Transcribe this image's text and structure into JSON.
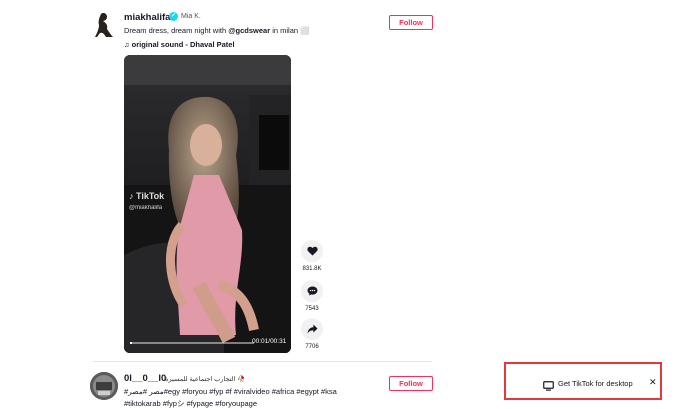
{
  "post1": {
    "username": "miakhalifa",
    "nickname": "Mia K.",
    "caption_text": "Dream dress, dream night with ",
    "caption_tag": "@gcdswear",
    "caption_end": " in milan ⬜",
    "sound": "original sound - Dhaval Patel",
    "follow_label": "Follow",
    "watermark": "TikTok",
    "watermark_user": "@miakhalifa",
    "video_time": "00:01/00:31",
    "video_progress_percent": 2,
    "likes": "831.8K",
    "comments": "7543",
    "shares": "7706"
  },
  "post2": {
    "username": "0l__0__l0",
    "nickname": "التجارب اجتماعية للمسيرة 🥀",
    "tags_line1": "#مصر #مصر#egy #foryou #fyp #f #viralvideo #africa #egypt #ksa",
    "tags_line2": "#tiktokarab #fypシ #fypage #foryoupage",
    "follow_label": "Follow"
  },
  "desktop_prompt": {
    "label": "Get TikTok for desktop",
    "close_label": "✕"
  },
  "colors": {
    "accent": "#fe2c55",
    "highlight_box": "#e0393e",
    "verified": "#20d5ec"
  },
  "icons": [
    "music-note-icon",
    "verified-badge-icon",
    "heart-icon",
    "comment-icon",
    "share-icon",
    "monitor-icon",
    "close-icon",
    "tiktok-logo-icon"
  ]
}
